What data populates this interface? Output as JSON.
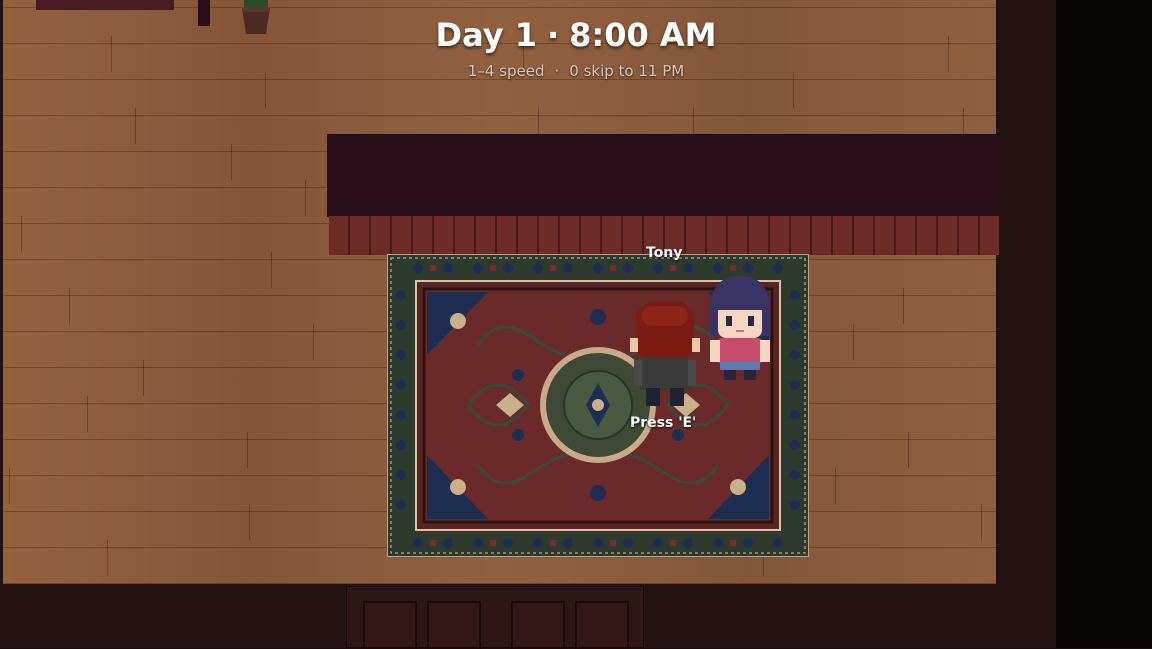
{
  "hud": {
    "day": "Day 1",
    "time": "8:00 AM",
    "hint_speed": "1–4 speed",
    "hint_skip": "0 skip to 11 PM",
    "separator": "·"
  },
  "npc": {
    "name": "Tony",
    "interact_prompt": "Press 'E'"
  },
  "colors": {
    "floor": "#8a5a3a",
    "counter_top": "#2a0f1a",
    "counter_front": "#6a2a26",
    "rug_field": "#6a2a2a",
    "rug_border": "#2f3a2e",
    "wall": "#241311"
  }
}
